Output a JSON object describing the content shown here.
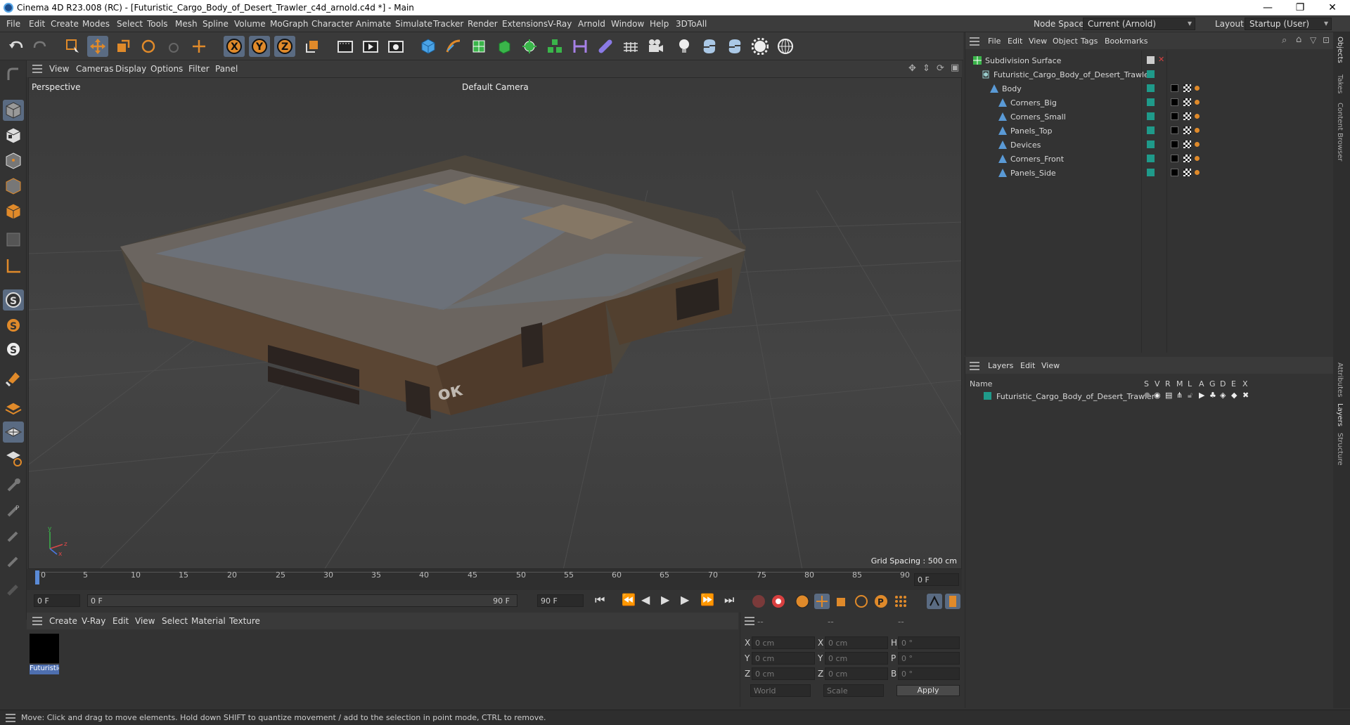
{
  "window": {
    "title": "Cinema 4D R23.008 (RC) - [Futuristic_Cargo_Body_of_Desert_Trawler_c4d_arnold.c4d *] - Main",
    "controls": [
      "—",
      "❐",
      "✕"
    ]
  },
  "menubar": {
    "items": [
      "File",
      "Edit",
      "Create",
      "Modes",
      "Select",
      "Tools",
      "Mesh",
      "Spline",
      "Volume",
      "MoGraph",
      "Character",
      "Animate",
      "Simulate",
      "Tracker",
      "Render",
      "Extensions",
      "V-Ray",
      "Arnold",
      "Window",
      "Help",
      "3DToAll"
    ],
    "node_space_label": "Node Space:",
    "node_space_value": "Current (Arnold)",
    "layout_label": "Layout:",
    "layout_value": "Startup (User)"
  },
  "toolbar": {
    "icons": [
      "undo-icon",
      "redo-icon",
      "live-select-icon",
      "move-icon",
      "scale-icon",
      "rotate-icon",
      "recent-tools-icon",
      "last-tool-icon",
      "x-axis-icon",
      "y-axis-icon",
      "z-axis-icon",
      "coordinate-system-icon",
      "render-region-icon",
      "render-view-icon",
      "render-settings-icon",
      "cube-icon",
      "pen-icon",
      "subdivision-icon",
      "extrude-icon",
      "cloner-icon",
      "instance-icon",
      "deformer-icon",
      "field-icon",
      "floor-icon",
      "camera-icon",
      "light-icon",
      "python-icon",
      "python-script-icon",
      "settings-icon",
      "arnold-icon"
    ]
  },
  "viewport": {
    "menu": [
      "View",
      "Cameras",
      "Display",
      "Options",
      "Filter",
      "Panel"
    ],
    "label": "Perspective",
    "camera": "Default Camera",
    "grid_spacing": "Grid Spacing : 500 cm",
    "model_marking": "ок"
  },
  "timeline": {
    "ticks": [
      "0",
      "5",
      "10",
      "15",
      "20",
      "25",
      "30",
      "35",
      "40",
      "45",
      "50",
      "55",
      "60",
      "65",
      "70",
      "75",
      "80",
      "85",
      "90"
    ],
    "current_frame": "0 F"
  },
  "transport": {
    "start_field": "0 F",
    "range_start": "0 F",
    "range_end": "90 F",
    "end_field": "90 F"
  },
  "material_manager": {
    "menu": [
      "Create",
      "V-Ray",
      "Edit",
      "View",
      "Select",
      "Material",
      "Texture"
    ],
    "material_name": "Futuristic",
    "material_color": "#000000"
  },
  "coordinates": {
    "headers": [
      "--",
      "--",
      "--"
    ],
    "rows": [
      {
        "a": "X",
        "av": "0 cm",
        "b": "X",
        "bv": "0 cm",
        "c": "H",
        "cv": "0 °"
      },
      {
        "a": "Y",
        "av": "0 cm",
        "b": "Y",
        "bv": "0 cm",
        "c": "P",
        "cv": "0 °"
      },
      {
        "a": "Z",
        "av": "0 cm",
        "b": "Z",
        "bv": "0 cm",
        "c": "B",
        "cv": "0 °"
      }
    ],
    "mode1": "World",
    "mode2": "Scale",
    "apply": "Apply"
  },
  "object_manager": {
    "menu": [
      "File",
      "Edit",
      "View",
      "Object",
      "Tags",
      "Bookmarks"
    ],
    "objects": [
      {
        "name": "Subdivision Surface",
        "indent": 0,
        "icon": "subdivision-icon"
      },
      {
        "name": "Futuristic_Cargo_Body_of_Desert_Trawler",
        "indent": 1,
        "icon": "null-icon"
      },
      {
        "name": "Body",
        "indent": 2,
        "icon": "polygon-icon"
      },
      {
        "name": "Corners_Big",
        "indent": 3,
        "icon": "polygon-icon"
      },
      {
        "name": "Corners_Small",
        "indent": 3,
        "icon": "polygon-icon"
      },
      {
        "name": "Panels_Top",
        "indent": 3,
        "icon": "polygon-icon"
      },
      {
        "name": "Devices",
        "indent": 3,
        "icon": "polygon-icon"
      },
      {
        "name": "Corners_Front",
        "indent": 3,
        "icon": "polygon-icon"
      },
      {
        "name": "Panels_Side",
        "indent": 3,
        "icon": "polygon-icon"
      }
    ]
  },
  "layer_manager": {
    "menu": [
      "Layers",
      "Edit",
      "View"
    ],
    "name_header": "Name",
    "flags": [
      "S",
      "V",
      "R",
      "M",
      "L",
      "A",
      "G",
      "D",
      "E",
      "X"
    ],
    "layer_name": "Futuristic_Cargo_Body_of_Desert_Trawler",
    "layer_color": "#1f9a8a"
  },
  "right_tabs": [
    "Objects",
    "Takes",
    "Content Browser",
    "Attributes",
    "Layers",
    "Structure"
  ],
  "status": "Move: Click and drag to move elements. Hold down SHIFT to quantize movement / add to the selection in point mode, CTRL to remove.",
  "colors": {
    "accent_selected": "#5a6b82",
    "teal_tag": "#1f9a8a",
    "orange_icon": "#e08a2a"
  }
}
